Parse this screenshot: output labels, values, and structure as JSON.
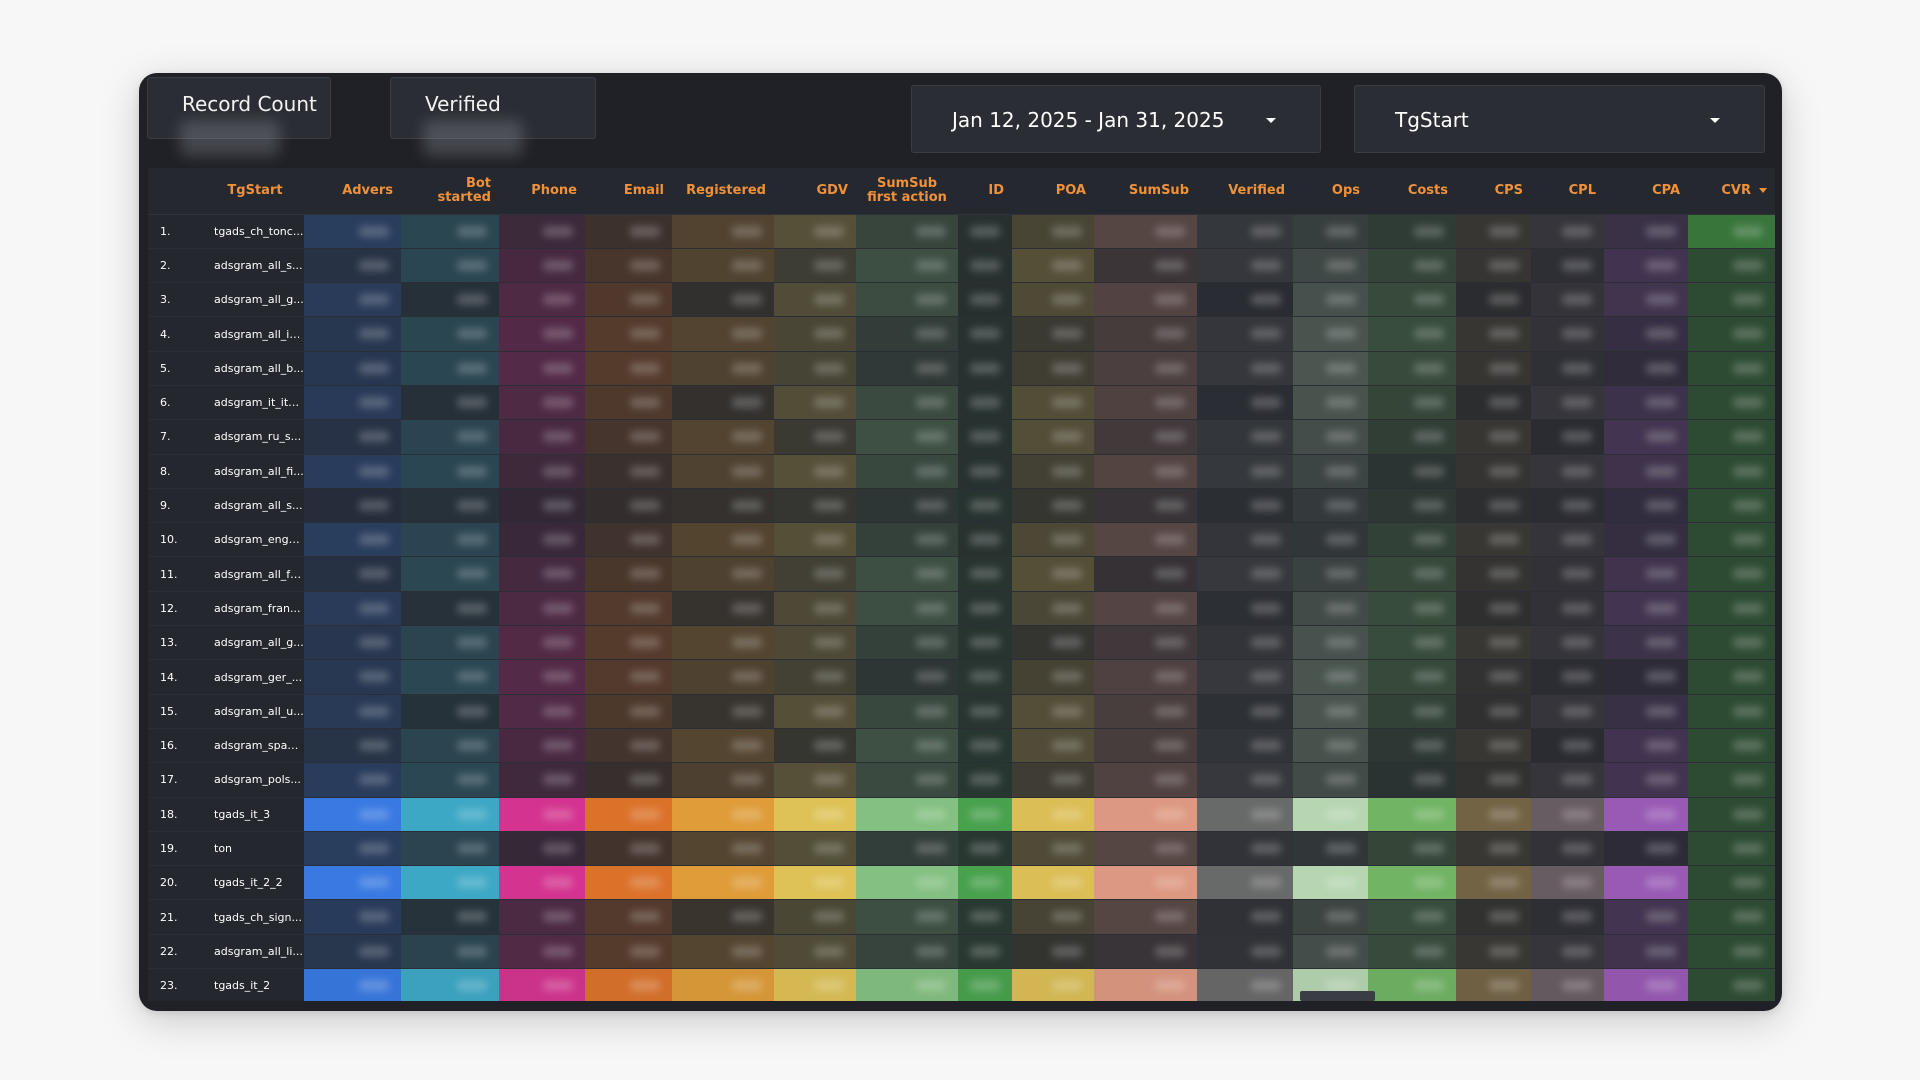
{
  "cards": {
    "record_count": {
      "label": "Record Count"
    },
    "verified": {
      "label": "Verified"
    }
  },
  "filters": {
    "date_range": "Jan 12, 2025 - Jan 31, 2025",
    "source": "TgStart"
  },
  "table": {
    "headers": [
      "TgStart",
      "Advers",
      "Bot started",
      "Phone",
      "Email",
      "Registered",
      "GDV",
      "SumSub first action",
      "ID",
      "POA",
      "SumSub",
      "Verified",
      "Ops",
      "Costs",
      "CPS",
      "CPL",
      "CPA",
      "CVR"
    ],
    "rows": [
      {
        "index": "1.",
        "name": "tgads_ch_tonc..."
      },
      {
        "index": "2.",
        "name": "adsgram_all_s..."
      },
      {
        "index": "3.",
        "name": "adsgram_all_g..."
      },
      {
        "index": "4.",
        "name": "adsgram_all_it..."
      },
      {
        "index": "5.",
        "name": "adsgram_all_b..."
      },
      {
        "index": "6.",
        "name": "adsgram_it_it_..."
      },
      {
        "index": "7.",
        "name": "adsgram_ru_s..."
      },
      {
        "index": "8.",
        "name": "adsgram_all_fi..."
      },
      {
        "index": "9.",
        "name": "adsgram_all_s..."
      },
      {
        "index": "10.",
        "name": "adsgram_eng_..."
      },
      {
        "index": "11.",
        "name": "adsgram_all_fr..."
      },
      {
        "index": "12.",
        "name": "adsgram_fran..."
      },
      {
        "index": "13.",
        "name": "adsgram_all_g..."
      },
      {
        "index": "14.",
        "name": "adsgram_ger_..."
      },
      {
        "index": "15.",
        "name": "adsgram_all_u..."
      },
      {
        "index": "16.",
        "name": "adsgram_span..."
      },
      {
        "index": "17.",
        "name": "adsgram_pols..."
      },
      {
        "index": "18.",
        "name": "tgads_it_3"
      },
      {
        "index": "19.",
        "name": "ton"
      },
      {
        "index": "20.",
        "name": "tgads_it_2_2"
      },
      {
        "index": "21.",
        "name": "tgads_ch_sign..."
      },
      {
        "index": "22.",
        "name": "adsgram_all_li..."
      },
      {
        "index": "23.",
        "name": "tgads_it_2"
      }
    ]
  },
  "column_colors": [
    "#3a82f6",
    "#3fb6d6",
    "#e8349a",
    "#ef7a2a",
    "#f4a93a",
    "#f3d35a",
    "#8fd18a",
    "#4caf50",
    "#f0cf5a",
    "#f2a58a",
    "#707070",
    "#c6e9c0",
    "#79c46a",
    "#7c6a48",
    "#6e6268",
    "#a560c4",
    "#3f8f3f"
  ]
}
